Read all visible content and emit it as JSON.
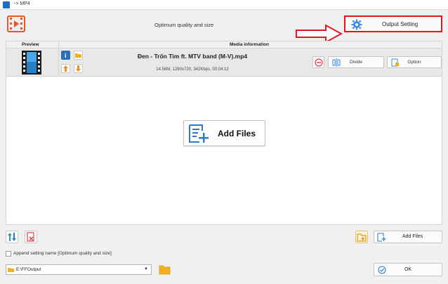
{
  "window": {
    "title": "-> MP4"
  },
  "header": {
    "subtitle": "Optimum quality and size",
    "output_setting_label": "Output Setting"
  },
  "columns": {
    "preview": "Preview",
    "media_info": "Media information"
  },
  "file": {
    "name": "Đen - Trốn Tìm ft. MTV band (M-V).mp4",
    "meta": "14.56M, 1280x720, 342Kbps, 00:04:12",
    "divide_label": "Divide",
    "option_label": "Option"
  },
  "main": {
    "add_files_label": "Add Files"
  },
  "bottom": {
    "add_files_label": "Add Files",
    "append_label": "Append setting name [Optimum quality and size]",
    "append_checked": false,
    "output_path": "E:\\FFOutput",
    "ok_label": "OK"
  },
  "colors": {
    "accent_blue": "#1f6fc5",
    "highlight_red": "#e4161c",
    "folder_orange": "#f2b01e",
    "remove_red": "#e0404a"
  }
}
